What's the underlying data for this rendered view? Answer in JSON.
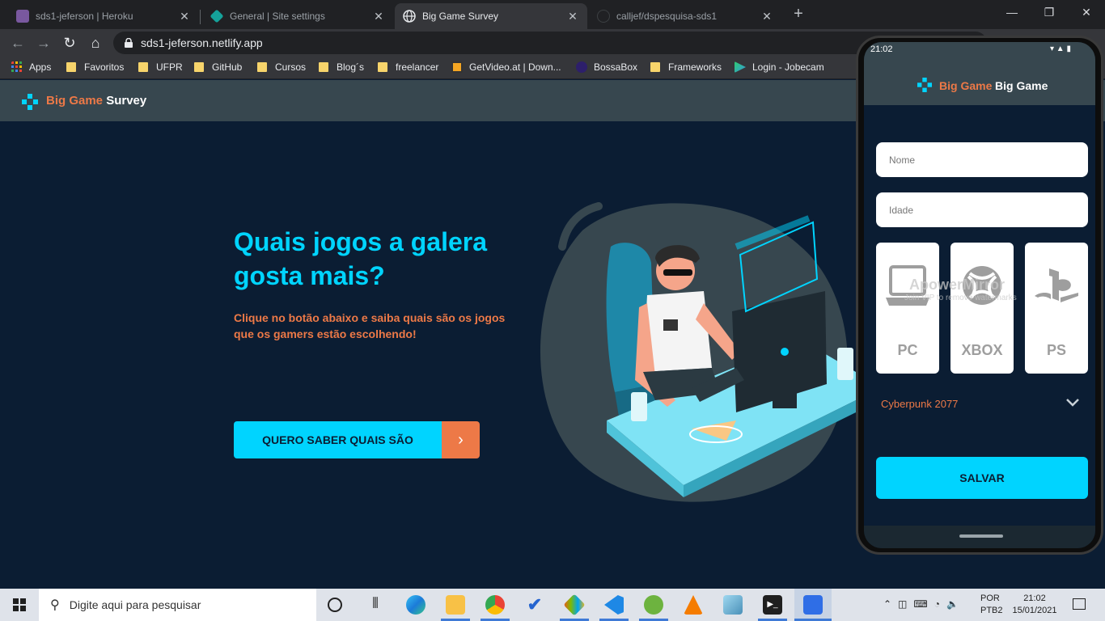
{
  "browser": {
    "tabs": [
      {
        "title": "sds1-jeferson | Heroku",
        "active": false,
        "color": "#79589f"
      },
      {
        "title": "General | Site settings",
        "active": false,
        "color": "#15a29a"
      },
      {
        "title": "Big Game Survey",
        "active": true,
        "color": "#ffffff"
      },
      {
        "title": "calljef/dspesquisa-sds1",
        "active": false,
        "color": "#202124"
      }
    ],
    "new_tab": "+",
    "url": "sds1-jeferson.netlify.app",
    "bookmarks": [
      {
        "label": "Apps",
        "icon": "apps-grid-icon"
      },
      {
        "label": "Favoritos",
        "icon": "folder-icon"
      },
      {
        "label": "UFPR",
        "icon": "folder-icon"
      },
      {
        "label": "GitHub",
        "icon": "folder-icon"
      },
      {
        "label": "Cursos",
        "icon": "folder-icon"
      },
      {
        "label": "Blog´s",
        "icon": "folder-icon"
      },
      {
        "label": "freelancer",
        "icon": "folder-icon"
      },
      {
        "label": "GetVideo.at | Down...",
        "icon": "getvideo-icon"
      },
      {
        "label": "BossaBox",
        "icon": "bossabox-icon"
      },
      {
        "label": "Frameworks",
        "icon": "folder-icon"
      },
      {
        "label": "Login - Jobecam",
        "icon": "jobecam-icon"
      }
    ]
  },
  "site": {
    "logo_orange": "Big Game",
    "logo_white": "Survey",
    "hero_title": "Quais jogos a galera gosta mais?",
    "hero_subtitle": "Clique no botão abaixo e saiba quais são os jogos que os gamers estão escolhendo!",
    "cta_label": "QUERO SABER QUAIS SÃO",
    "cta_arrow": "›"
  },
  "phone": {
    "time": "21:02",
    "header_orange": "Big Game",
    "header_white": "Big Game",
    "name_placeholder": "Nome",
    "age_placeholder": "Idade",
    "platforms": [
      "PC",
      "XBOX",
      "PS"
    ],
    "watermark_title": "ApowerMirror",
    "watermark_sub": "Join VIP to remove watermarks",
    "selected_game": "Cyberpunk 2077",
    "save_label": "SALVAR"
  },
  "taskbar": {
    "search_placeholder": "Digite aqui para pesquisar",
    "lang": "POR",
    "layout": "PTB2",
    "time": "21:02",
    "date": "15/01/2021"
  },
  "colors": {
    "bg": "#0b1d33",
    "cyan": "#00d4ff",
    "orange": "#ed7947",
    "header": "#37474f"
  }
}
